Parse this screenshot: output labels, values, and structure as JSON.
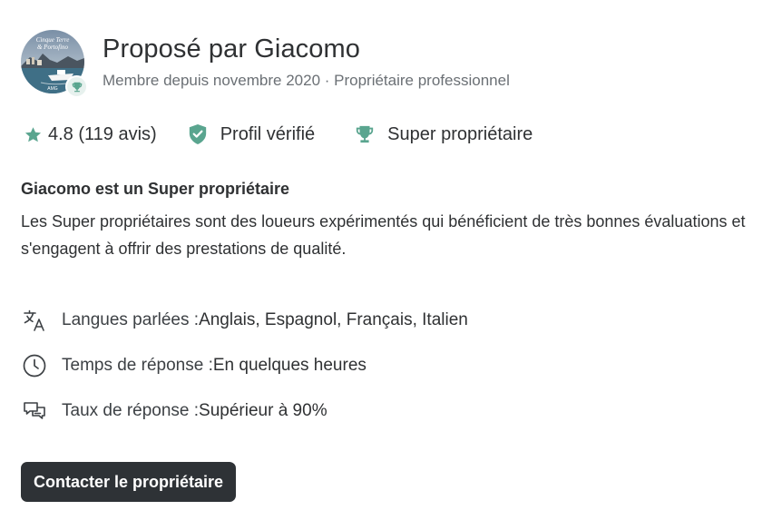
{
  "owner": {
    "title": "Proposé par Giacomo",
    "subtitle": "Membre depuis novembre 2020 · Propriétaire professionnel",
    "avatar_logo_text": "Cinque Terre & Portofino",
    "avatar_logo_small": "AMG"
  },
  "badges": {
    "rating": "4.8 (119 avis)",
    "verified": "Profil vérifié",
    "super_owner": "Super propriétaire"
  },
  "super_owner_info": {
    "heading": "Giacomo est un Super propriétaire",
    "description": "Les Super propriétaires sont des loueurs expérimentés qui bénéficient de très bonnes évaluations et s'engagent à offrir des prestations de qualité."
  },
  "details": {
    "languages_label": "Langues parlées : ",
    "languages_value": "Anglais, Espagnol, Français, Italien",
    "response_time_label": "Temps de réponse : ",
    "response_time_value": "En quelques heures",
    "response_rate_label": "Taux de réponse : ",
    "response_rate_value": "Supérieur à 90%"
  },
  "contact_button_label": "Contacter le propriétaire",
  "colors": {
    "accent_green": "#5aa58f",
    "button_dark": "#2e3236",
    "text_dark": "#2f3133",
    "text_muted": "#6b7075"
  },
  "icons": [
    "star-icon",
    "shield-check-icon",
    "trophy-icon",
    "translate-icon",
    "clock-icon",
    "chat-icon"
  ]
}
